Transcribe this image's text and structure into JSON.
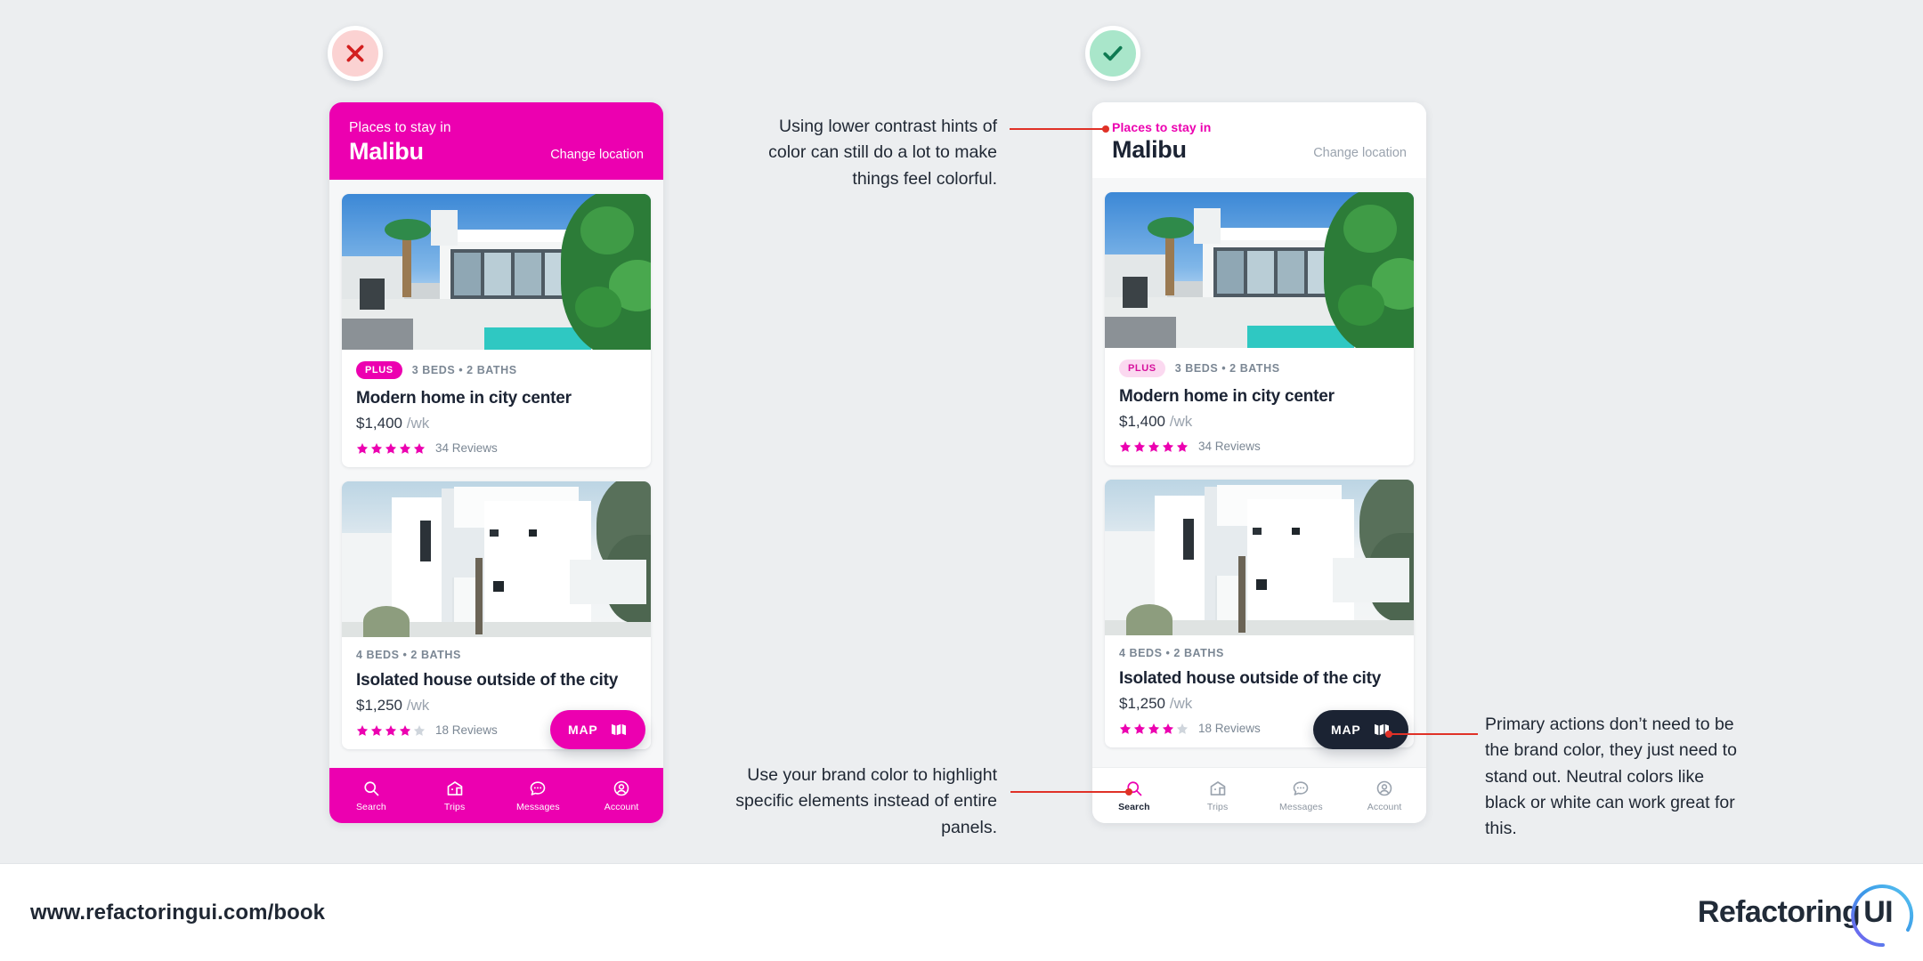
{
  "page": {
    "background": "#eceef0",
    "brand_magenta": "#ec00b0",
    "neutral_dark": "#1b2333",
    "leader_red": "#e03127"
  },
  "badges": {
    "bad": {
      "name": "cross-badge",
      "glyph": "✕",
      "fill": "#fbd2d2",
      "stroke": "#d31f1f"
    },
    "good": {
      "name": "check-badge",
      "glyph": "✓",
      "fill": "#a9e6ca",
      "stroke": "#0f7a52"
    }
  },
  "phones": [
    {
      "variant": "bad",
      "header": {
        "eyebrow": "Places to stay in",
        "city": "Malibu",
        "change_location": "Change location"
      },
      "cards": [
        {
          "photo": "modern-villa-with-pool",
          "plus_badge": "PLUS",
          "beds_baths": "3 BEDS • 2 BATHS",
          "title": "Modern home in city center",
          "price": "$1,400",
          "price_unit": "/wk",
          "stars_filled": 5,
          "stars_total": 5,
          "reviews": "34 Reviews"
        },
        {
          "photo": "white-minimal-house",
          "plus_badge": null,
          "beds_baths": "4 BEDS • 2 BATHS",
          "title": "Isolated house outside of the city",
          "price": "$1,250",
          "price_unit": "/wk",
          "stars_filled": 4,
          "stars_total": 5,
          "reviews": "18 Reviews"
        }
      ],
      "fab": {
        "label": "MAP",
        "icon": "map-bars-icon",
        "background": "#ec00b0"
      },
      "nav": {
        "background": "#ec00b0",
        "items": [
          {
            "label": "Search",
            "icon": "search-icon",
            "active": true
          },
          {
            "label": "Trips",
            "icon": "house-icon",
            "active": false
          },
          {
            "label": "Messages",
            "icon": "chat-bubble-icon",
            "active": false
          },
          {
            "label": "Account",
            "icon": "user-circle-icon",
            "active": false
          }
        ]
      }
    },
    {
      "variant": "good",
      "header": {
        "eyebrow": "Places to stay in",
        "city": "Malibu",
        "change_location": "Change location"
      },
      "cards": [
        {
          "photo": "modern-villa-with-pool",
          "plus_badge": "PLUS",
          "beds_baths": "3 BEDS • 2 BATHS",
          "title": "Modern home in city center",
          "price": "$1,400",
          "price_unit": "/wk",
          "stars_filled": 5,
          "stars_total": 5,
          "reviews": "34 Reviews"
        },
        {
          "photo": "white-minimal-house",
          "plus_badge": null,
          "beds_baths": "4 BEDS • 2 BATHS",
          "title": "Isolated house outside of the city",
          "price": "$1,250",
          "price_unit": "/wk",
          "stars_filled": 4,
          "stars_total": 5,
          "reviews": "18 Reviews"
        }
      ],
      "fab": {
        "label": "MAP",
        "icon": "map-bars-icon",
        "background": "#1b2333"
      },
      "nav": {
        "background": "#ffffff",
        "items": [
          {
            "label": "Search",
            "icon": "search-icon",
            "active": true
          },
          {
            "label": "Trips",
            "icon": "house-icon",
            "active": false
          },
          {
            "label": "Messages",
            "icon": "chat-bubble-icon",
            "active": false
          },
          {
            "label": "Account",
            "icon": "user-circle-icon",
            "active": false
          }
        ]
      }
    }
  ],
  "annotations": {
    "a": "Using lower contrast hints of color can still do a lot to make things feel colorful.",
    "b": "Use your brand color to highlight specific elements instead of entire panels.",
    "c": "Primary actions don’t need to be the brand color, they just need to stand out. Neutral colors like black or white can work great for this."
  },
  "footer": {
    "url": "www.refactoringui.com/book",
    "logo_text": "Refactoring",
    "logo_mark": "UI"
  }
}
